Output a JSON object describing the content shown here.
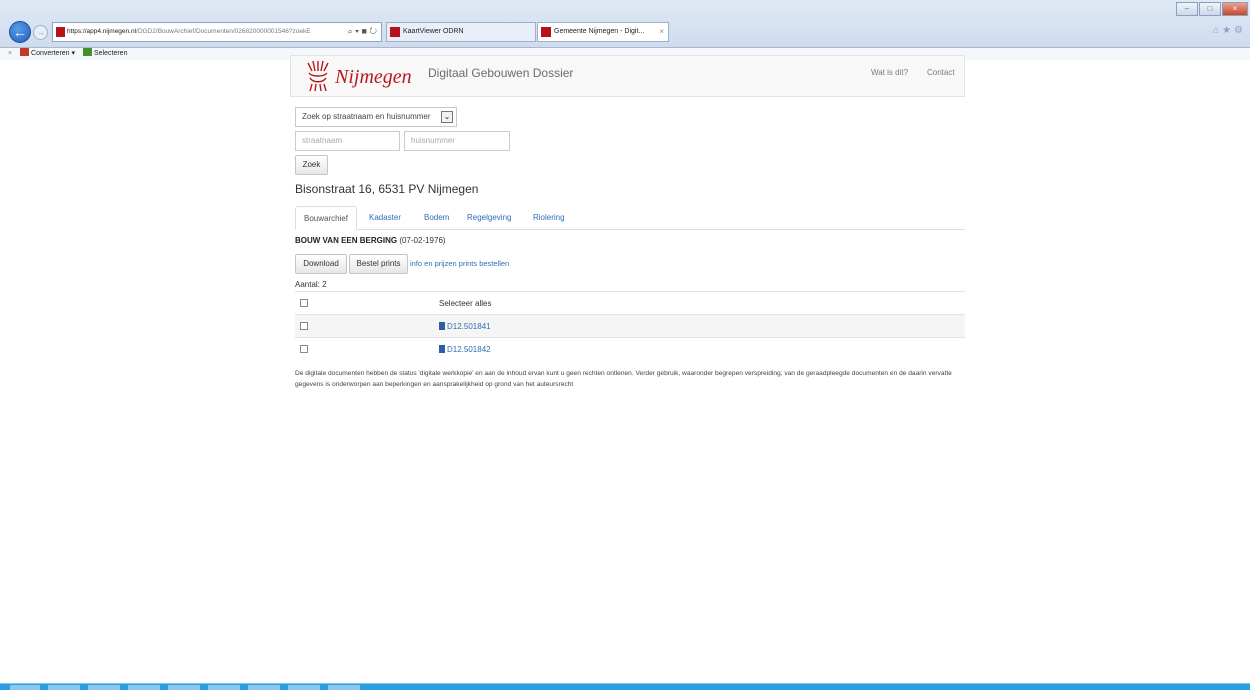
{
  "browser": {
    "url_host": "https://app4.nijmegen.nl",
    "url_path": "/DGD2/BouwArchief/Documenten/026820000001546?zoekE",
    "tabs": [
      {
        "label": "KaartViewer ODRN"
      },
      {
        "label": "Gemeente Nijmegen - Digit..."
      }
    ],
    "commandbar": {
      "convert_label": "Converteren",
      "select_label": "Selecteren"
    }
  },
  "header": {
    "logo_text": "Nijmegen",
    "subtitle": "Digitaal Gebouwen Dossier",
    "nav": [
      "Wat is dit?",
      "Contact"
    ]
  },
  "search": {
    "mode_value": "Zoek op straatnaam en huisnummer",
    "street_placeholder": "straatnaam",
    "number_placeholder": "huisnummer",
    "submit_label": "Zoek"
  },
  "address": "Bisonstraat 16, 6531 PV Nijmegen",
  "tabs": [
    "Bouwarchief",
    "Kadaster",
    "Bodem",
    "Regelgeving",
    "Riolering"
  ],
  "dossier": {
    "title": "BOUW VAN EEN BERGING",
    "date": "(07-02-1976)"
  },
  "actions": {
    "download_label": "Download",
    "order_label": "Bestel prints",
    "info_link": "info en prijzen prints bestellen"
  },
  "count_label": "Aantal: 2",
  "table": {
    "select_all_label": "Selecteer alles",
    "rows": [
      {
        "doc": "D12.501841"
      },
      {
        "doc": "D12.501842"
      }
    ]
  },
  "disclaimer": "De digitale documenten hebben de status 'digitale werkkopie' en aan de inhoud ervan kunt u geen rechten ontlenen. Verder gebruik, waaronder begrepen verspreiding, van de geraadpleegde documenten en de daarin vervatte gegevens is onderworpen aan beperkingen en aansprakelijkheid op grond van het auteursrecht",
  "colors": {
    "brand_red": "#b7181f",
    "link_blue": "#2f6db5",
    "taskbar": "#2a9fe2"
  }
}
